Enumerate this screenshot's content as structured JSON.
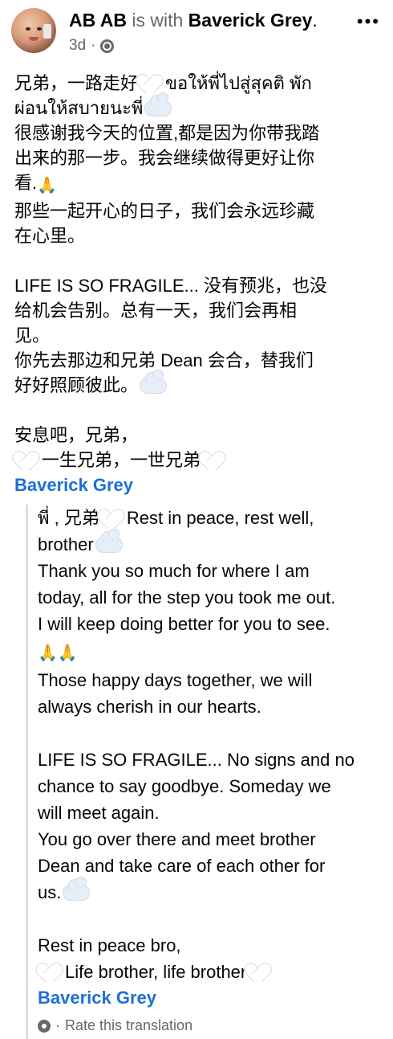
{
  "post": {
    "author": "AB AB",
    "with_text": "is with",
    "tagged": "Baverick Grey",
    "period": ".",
    "time": "3d",
    "dot": "·",
    "more": "•••"
  },
  "original": {
    "lines": [
      [
        "兄弟，一路走好",
        "heart",
        "ขอให้พี่ไปสู่สุคติ พัก"
      ],
      [
        "ผ่อนให้สบายนะพี่",
        "cloud"
      ],
      [
        "很感谢我今天的位置,都是因为你带我踏"
      ],
      [
        "出来的那一步。我会继续做得更好让你"
      ],
      [
        "看.",
        "pray"
      ],
      [
        "那些一起开心的日子，我们会永远珍藏"
      ],
      [
        "在心里。"
      ],
      [
        ""
      ],
      [
        "LIFE IS SO FRAGILE... 没有预兆，也没"
      ],
      [
        "给机会告别。总有一天，我们会再相"
      ],
      [
        "见。"
      ],
      [
        "你先去那边和兄弟 Dean 会合，替我们"
      ],
      [
        "好好照顾彼此。",
        "cloud"
      ],
      [
        ""
      ],
      [
        "安息吧，兄弟，"
      ],
      [
        "heart",
        "一生兄弟，一世兄弟",
        "heart"
      ]
    ],
    "mention": "Baverick Grey"
  },
  "translation": {
    "lines": [
      [
        "พี่ , 兄弟",
        "heart",
        "Rest in peace, rest well,"
      ],
      [
        "brother",
        "cloud"
      ],
      [
        "Thank you so much for where I am"
      ],
      [
        "today, all for the step you took me out."
      ],
      [
        "I will keep doing better for you to see."
      ],
      [
        "pray",
        "pray"
      ],
      [
        "Those happy days together, we will"
      ],
      [
        "always cherish in our hearts."
      ],
      [
        ""
      ],
      [
        "LIFE IS SO FRAGILE... No signs and no"
      ],
      [
        "chance to say goodbye. Someday we"
      ],
      [
        "will meet again."
      ],
      [
        "You go over there and meet brother"
      ],
      [
        "Dean and take care of each other for"
      ],
      [
        "us.",
        "cloud"
      ],
      [
        ""
      ],
      [
        "Rest in peace bro,"
      ],
      [
        "heart",
        "Life brother, life brother",
        "heart"
      ]
    ],
    "mention": "Baverick Grey",
    "footer_dot": "·",
    "footer_label": "Rate this translation"
  },
  "emoji": {
    "heart": "white-heart-icon",
    "cloud": "cloud-icon",
    "pray": "folded-hands-icon"
  }
}
